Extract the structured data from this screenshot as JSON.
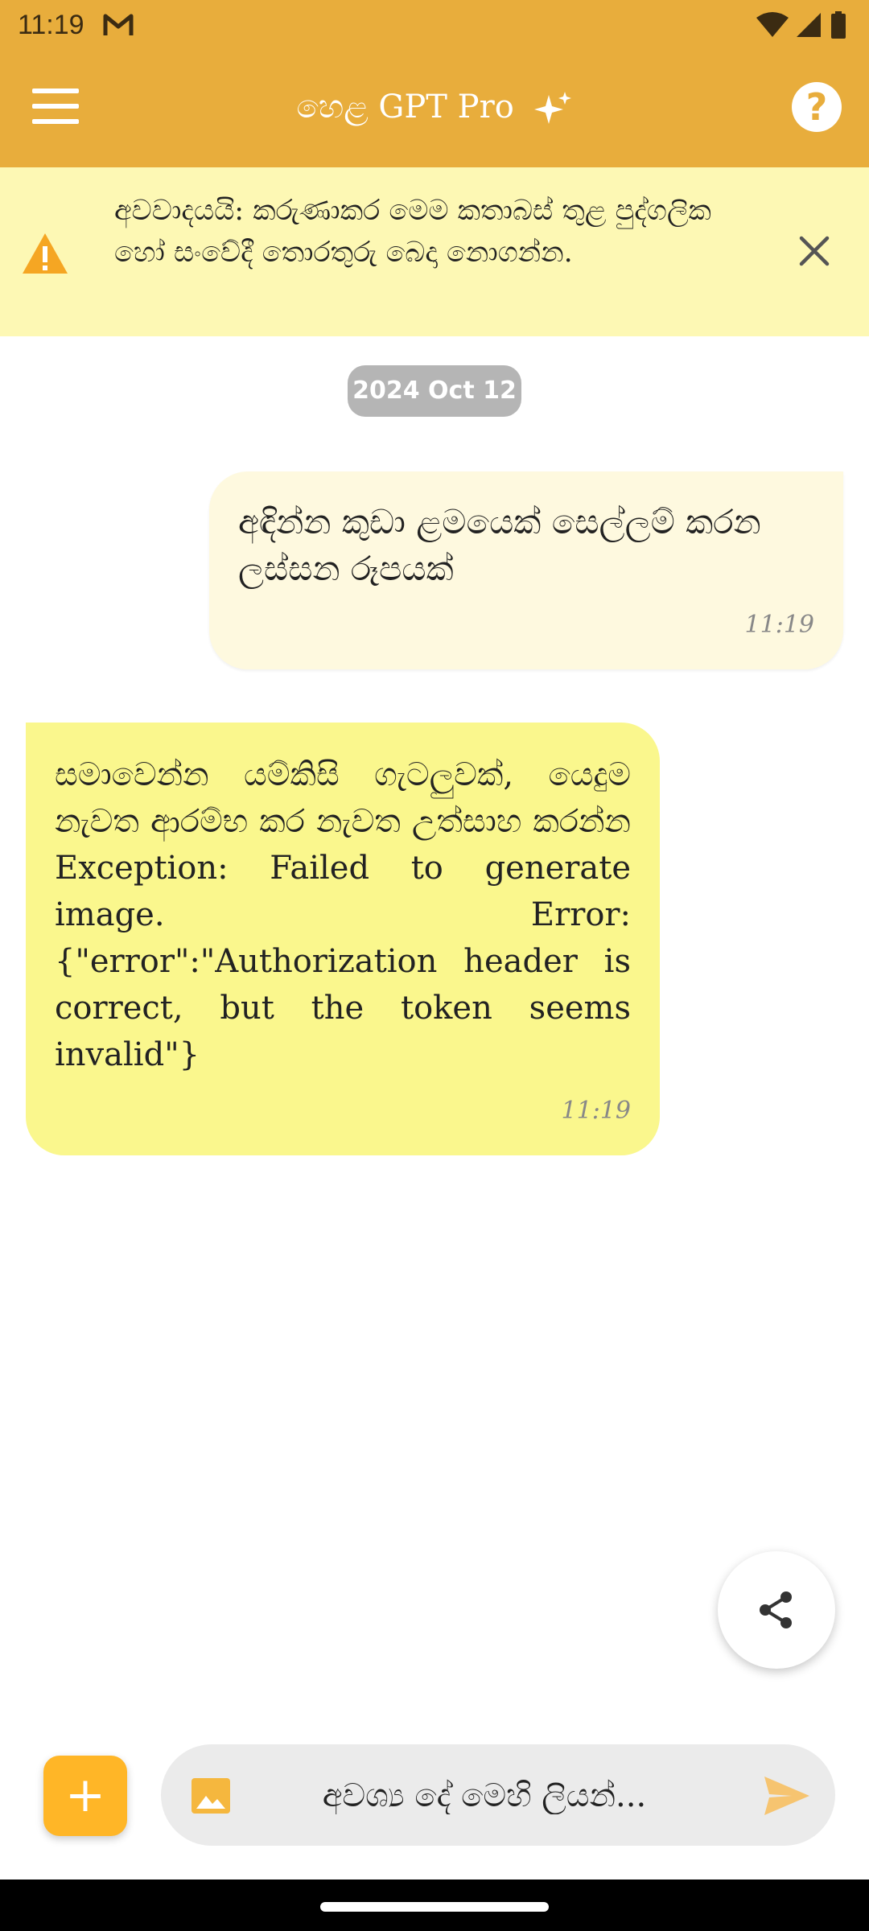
{
  "status_bar": {
    "time": "11:19"
  },
  "app_bar": {
    "title": "හෙළ GPT Pro"
  },
  "warning": {
    "text": "අවවාදයයි: කරුණාකර මෙම කතාබස් තුළ පුද්ගලික හෝ සංවේදී තොරතුරු බෙදා නොගන්න."
  },
  "chat": {
    "date_chip": "2024 Oct 12",
    "messages": [
      {
        "sender": "user",
        "text": "අඳින්න කුඩා ළමයෙක් සෙල්ලම් කරන ලස්සන රූපයක්",
        "time": "11:19"
      },
      {
        "sender": "bot",
        "text": "සමාවෙන්න යම්කිසි ගැටලුවක්, යෙදුම නැවත ආරම්භ කර නැවත උත්සාහ කරන්න Exception: Failed to generate image. Error: {\"error\":\"Authorization header is correct, but the token seems invalid\"}",
        "time": "11:19"
      }
    ]
  },
  "composer": {
    "placeholder": "අවශ්‍ය දේ මෙහි ලියන්..."
  },
  "colors": {
    "accent": "#E8AD3C",
    "warning_bg": "#FDF8B4",
    "user_bubble": "#FEF9DF",
    "bot_bubble": "#FAF78D",
    "fab": "#FFB627"
  },
  "icons": {
    "menu": "menu-icon",
    "sparkle": "sparkle-icon",
    "help": "help-icon",
    "warning": "warning-icon",
    "close": "close-icon",
    "share": "share-icon",
    "add": "plus-icon",
    "image": "image-icon",
    "send": "send-icon"
  }
}
